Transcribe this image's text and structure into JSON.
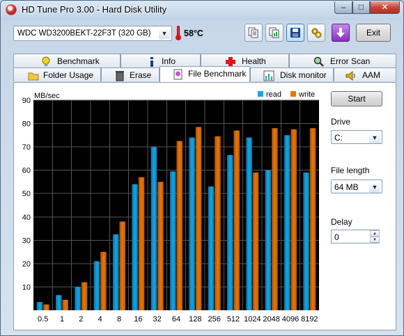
{
  "window": {
    "title": "HD Tune Pro 3.00 - Hard Disk Utility",
    "min_glyph": "–",
    "max_glyph": "□",
    "close_glyph": "✕"
  },
  "toolbar": {
    "drive": "WDC WD3200BEKT-22F3T (320 GB)",
    "temperature": "58°C",
    "exit_label": "Exit",
    "icons": [
      "copy-text-icon",
      "copy-screenshot-icon",
      "save-icon",
      "options-icon",
      "down-arrow-icon"
    ]
  },
  "tabs": {
    "row1": [
      {
        "label": "Benchmark",
        "icon": "lightbulb-icon"
      },
      {
        "label": "Info",
        "icon": "info-icon"
      },
      {
        "label": "Health",
        "icon": "health-cross-icon"
      },
      {
        "label": "Error Scan",
        "icon": "magnifier-icon"
      }
    ],
    "row2": [
      {
        "label": "Folder Usage",
        "icon": "folder-icon"
      },
      {
        "label": "Erase",
        "icon": "trash-icon"
      },
      {
        "label": "File Benchmark",
        "icon": "file-lightbulb-icon",
        "active": true
      },
      {
        "label": "Disk monitor",
        "icon": "chart-icon"
      },
      {
        "label": "AAM",
        "icon": "speaker-icon"
      }
    ]
  },
  "benchmark": {
    "start_label": "Start",
    "drive_label": "Drive",
    "drive_value": "C:",
    "file_length_label": "File length",
    "file_length_value": "64 MB",
    "delay_label": "Delay",
    "delay_value": "0"
  },
  "chart_data": {
    "type": "bar",
    "ylabel": "MB/sec",
    "ylim": [
      0,
      90
    ],
    "yticks": [
      10,
      20,
      30,
      40,
      50,
      60,
      70,
      80,
      90
    ],
    "categories": [
      "0.5",
      "1",
      "2",
      "4",
      "8",
      "16",
      "32",
      "64",
      "128",
      "256",
      "512",
      "1024",
      "2048",
      "4096",
      "8192"
    ],
    "series": [
      {
        "name": "read",
        "color": "#14a5e6",
        "values": [
          3.5,
          6.5,
          10,
          21,
          32.5,
          54,
          70,
          59.5,
          74,
          53,
          66.5,
          74,
          60,
          75,
          59
        ]
      },
      {
        "name": "write",
        "color": "#e8760a",
        "values": [
          2.5,
          4.5,
          12,
          25,
          38,
          57,
          55,
          72.5,
          78.5,
          74.5,
          77,
          59,
          78,
          77.5,
          78
        ]
      }
    ],
    "legend_position": "top-right",
    "grid": true,
    "background": "#000000"
  }
}
